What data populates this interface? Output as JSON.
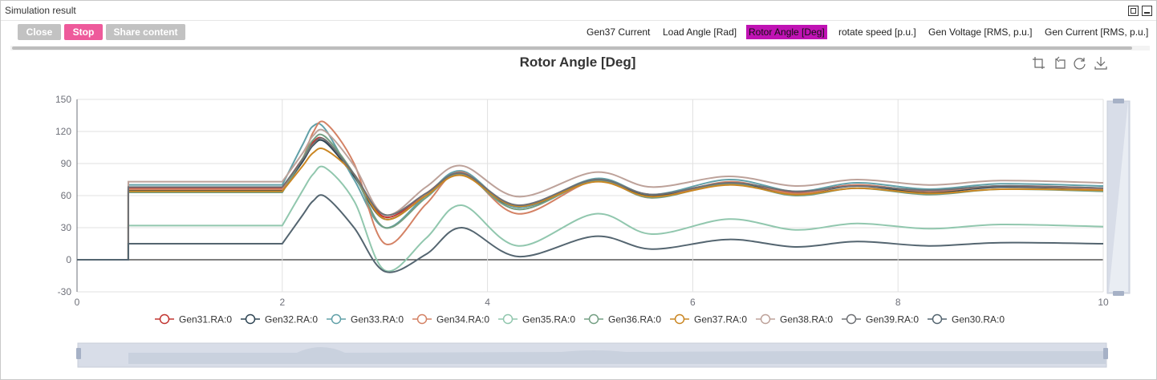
{
  "window": {
    "title": "Simulation result"
  },
  "toolbar": {
    "close_label": "Close",
    "stop_label": "Stop",
    "share_label": "Share content"
  },
  "tabs": [
    {
      "label": "Gen37 Current",
      "active": false
    },
    {
      "label": "Load Angle [Rad]",
      "active": false
    },
    {
      "label": "Rotor Angle [Deg]",
      "active": true
    },
    {
      "label": "rotate speed [p.u.]",
      "active": false
    },
    {
      "label": "Gen Voltage [RMS, p.u.]",
      "active": false
    },
    {
      "label": "Gen Current [RMS, p.u.]",
      "active": false
    }
  ],
  "toolbox_icons": [
    "zoom-icon",
    "zoom-reset-icon",
    "restore-icon",
    "download-icon"
  ],
  "chart_data": {
    "type": "line",
    "title": "Rotor Angle [Deg]",
    "xlabel": "",
    "ylabel": "",
    "xlim": [
      0,
      10
    ],
    "ylim": [
      -30,
      150
    ],
    "xticks": [
      0,
      2,
      4,
      6,
      8,
      10
    ],
    "yticks": [
      -30,
      0,
      30,
      60,
      90,
      120,
      150
    ],
    "grid": true,
    "legend_position": "bottom",
    "fault_time": 0.5,
    "clear_time": 2.0,
    "x": [
      0.0,
      0.5,
      2.0,
      2.2,
      2.3,
      2.42,
      2.7,
      3.0,
      3.4,
      3.75,
      4.3,
      5.05,
      5.6,
      6.35,
      7.0,
      7.6,
      8.3,
      9.0,
      10.0
    ],
    "series": [
      {
        "name": "Gen31.RA:0",
        "color": "#c23531",
        "values": [
          0,
          67,
          67,
          95,
          110,
          112,
          80,
          40,
          62,
          81,
          50,
          75,
          61,
          72,
          63,
          70,
          64,
          69,
          67
        ]
      },
      {
        "name": "Gen32.RA:0",
        "color": "#2f4554",
        "values": [
          0,
          65,
          65,
          92,
          107,
          110,
          78,
          38,
          60,
          80,
          49,
          74,
          60,
          71,
          62,
          69,
          63,
          68,
          66
        ]
      },
      {
        "name": "Gen33.RA:0",
        "color": "#61a0a8",
        "values": [
          0,
          70,
          70,
          108,
          125,
          122,
          75,
          30,
          60,
          83,
          49,
          76,
          61,
          75,
          64,
          72,
          66,
          71,
          69
        ]
      },
      {
        "name": "Gen34.RA:0",
        "color": "#d48265",
        "values": [
          0,
          66,
          66,
          95,
          119,
          128,
          90,
          15,
          52,
          82,
          43,
          74,
          58,
          73,
          62,
          70,
          64,
          69,
          66
        ]
      },
      {
        "name": "Gen35.RA:0",
        "color": "#91c7ae",
        "values": [
          0,
          32,
          32,
          65,
          80,
          86,
          55,
          -10,
          20,
          51,
          13,
          43,
          24,
          38,
          28,
          34,
          29,
          33,
          31
        ]
      },
      {
        "name": "Gen36.RA:0",
        "color": "#749f83",
        "values": [
          0,
          63,
          63,
          95,
          112,
          115,
          80,
          30,
          58,
          80,
          47,
          74,
          58,
          71,
          60,
          67,
          61,
          66,
          64
        ]
      },
      {
        "name": "Gen37.RA:0",
        "color": "#ca8622",
        "values": [
          0,
          64,
          64,
          88,
          100,
          103,
          80,
          38,
          60,
          79,
          50,
          73,
          59,
          70,
          61,
          67,
          62,
          66,
          65
        ]
      },
      {
        "name": "Gen38.RA:0",
        "color": "#bda29a",
        "values": [
          0,
          73,
          73,
          100,
          116,
          120,
          88,
          42,
          68,
          88,
          59,
          82,
          68,
          78,
          69,
          75,
          70,
          74,
          72
        ]
      },
      {
        "name": "Gen39.RA:0",
        "color": "#6e7074",
        "values": [
          0,
          68,
          68,
          94,
          108,
          112,
          80,
          42,
          62,
          81,
          51,
          75,
          61,
          72,
          64,
          69,
          65,
          69,
          67
        ]
      },
      {
        "name": "Gen30.RA:0",
        "color": "#546570",
        "values": [
          0,
          15,
          15,
          42,
          55,
          59,
          30,
          -11,
          5,
          30,
          3,
          22,
          10,
          19,
          12,
          17,
          13,
          16,
          15
        ]
      }
    ]
  }
}
